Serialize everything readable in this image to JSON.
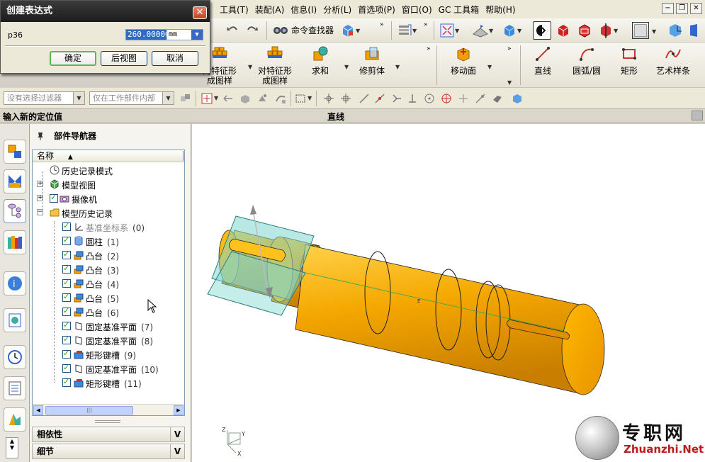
{
  "dialog": {
    "title": "创建表达式",
    "param_label": "p36",
    "value": "260.00000",
    "unit": "mm",
    "ok_label": "确定",
    "back_view_label": "后视图",
    "cancel_label": "取消"
  },
  "menu": {
    "items": [
      "工具(T)",
      "装配(A)",
      "信息(I)",
      "分析(L)",
      "首选项(P)",
      "窗口(O)",
      "GC 工具箱",
      "帮助(H)"
    ]
  },
  "toolbar": {
    "command_finder_label": "命令查找器",
    "buttons": [
      {
        "label": "对特征形成图样",
        "icon": "pattern-feature-icon"
      },
      {
        "label": "对特征形成图样",
        "icon": "pattern-face-icon"
      },
      {
        "label": "求和",
        "icon": "unite-icon"
      },
      {
        "label": "修剪体",
        "icon": "trim-body-icon"
      },
      {
        "label": "移动面",
        "icon": "move-face-icon"
      },
      {
        "label": "直线",
        "icon": "line-icon"
      },
      {
        "label": "圆弧/圆",
        "icon": "arc-icon"
      },
      {
        "label": "矩形",
        "icon": "rectangle-icon"
      },
      {
        "label": "艺术样条",
        "icon": "spline-icon"
      }
    ],
    "filter_dropdown": "没有选择过滤器",
    "scope_dropdown": "仅在工作部件内部"
  },
  "prompt": {
    "left": "输入新的定位值",
    "right": "直线"
  },
  "navigator": {
    "title": "部件导航器",
    "column_header": "名称",
    "nodes": [
      {
        "label": "历史记录模式",
        "num": "",
        "level": 0,
        "expander": "",
        "checked": false,
        "icon": "clock-icon",
        "grey": false
      },
      {
        "label": "模型视图",
        "num": "",
        "level": 0,
        "expander": "+",
        "checked": false,
        "icon": "model-views-icon",
        "grey": false
      },
      {
        "label": "摄像机",
        "num": "",
        "level": 0,
        "expander": "+",
        "checked": true,
        "icon": "camera-icon",
        "grey": false
      },
      {
        "label": "模型历史记录",
        "num": "",
        "level": 0,
        "expander": "−",
        "checked": false,
        "icon": "folder-icon",
        "grey": false
      },
      {
        "label": "基准坐标系",
        "num": "(0)",
        "level": 1,
        "expander": "",
        "checked": true,
        "icon": "datum-csys-icon",
        "grey": true
      },
      {
        "label": "圆柱",
        "num": "(1)",
        "level": 1,
        "expander": "",
        "checked": true,
        "icon": "cylinder-icon",
        "grey": false
      },
      {
        "label": "凸台",
        "num": "(2)",
        "level": 1,
        "expander": "",
        "checked": true,
        "icon": "boss-icon",
        "grey": false
      },
      {
        "label": "凸台",
        "num": "(3)",
        "level": 1,
        "expander": "",
        "checked": true,
        "icon": "boss-icon",
        "grey": false
      },
      {
        "label": "凸台",
        "num": "(4)",
        "level": 1,
        "expander": "",
        "checked": true,
        "icon": "boss-icon",
        "grey": false
      },
      {
        "label": "凸台",
        "num": "(5)",
        "level": 1,
        "expander": "",
        "checked": true,
        "icon": "boss-icon",
        "grey": false
      },
      {
        "label": "凸台",
        "num": "(6)",
        "level": 1,
        "expander": "",
        "checked": true,
        "icon": "boss-icon",
        "grey": false
      },
      {
        "label": "固定基准平面",
        "num": "(7)",
        "level": 1,
        "expander": "",
        "checked": true,
        "icon": "datum-plane-icon",
        "grey": false
      },
      {
        "label": "固定基准平面",
        "num": "(8)",
        "level": 1,
        "expander": "",
        "checked": true,
        "icon": "datum-plane-icon",
        "grey": false
      },
      {
        "label": "矩形键槽",
        "num": "(9)",
        "level": 1,
        "expander": "",
        "checked": true,
        "icon": "rect-slot-icon",
        "grey": false
      },
      {
        "label": "固定基准平面",
        "num": "(10)",
        "level": 1,
        "expander": "",
        "checked": true,
        "icon": "datum-plane-icon",
        "grey": false
      },
      {
        "label": "矩形键槽",
        "num": "(11)",
        "level": 1,
        "expander": "",
        "checked": true,
        "icon": "rect-slot-icon",
        "grey": false
      }
    ],
    "panels": [
      "相依性",
      "细节"
    ]
  },
  "watermark": {
    "zh": "专职网",
    "en": "Zhuanzhi.Net"
  },
  "colors": {
    "part": "#f5a800",
    "datum_plane": "#7fd6d0",
    "accent_selected": "#316ac5"
  }
}
